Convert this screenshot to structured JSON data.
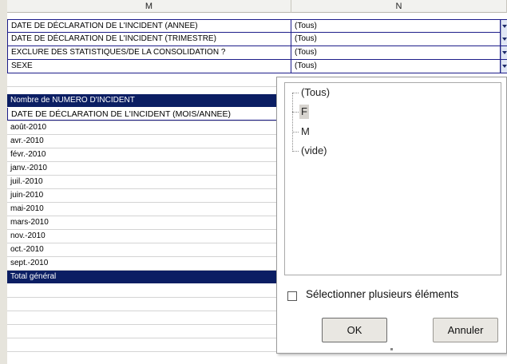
{
  "columns": {
    "m": "M",
    "n": "N"
  },
  "filters": [
    {
      "label": "DATE DE DÉCLARATION DE L'INCIDENT (ANNEE)",
      "value": "(Tous)"
    },
    {
      "label": "DATE DE DÉCLARATION DE L'INCIDENT (TRIMESTRE)",
      "value": "(Tous)"
    },
    {
      "label": "EXCLURE DES STATISTIQUES/DE LA CONSOLIDATION ?",
      "value": "(Tous)"
    },
    {
      "label": "SEXE",
      "value": "(Tous)"
    }
  ],
  "pivot": {
    "header": "Nombre de NUMERO D'INCIDENT",
    "row_field": "DATE DE DÉCLARATION DE L'INCIDENT (MOIS/ANNEE)",
    "rows": [
      "août-2010",
      "avr.-2010",
      "févr.-2010",
      "janv.-2010",
      "juil.-2010",
      "juin-2010",
      "mai-2010",
      "mars-2010",
      "nov.-2010",
      "oct.-2010",
      "sept.-2010"
    ],
    "total_label": "Total général"
  },
  "popup": {
    "options": [
      "(Tous)",
      "F",
      "M",
      "(vide)"
    ],
    "selected": "F",
    "multi_select_label": "Sélectionner plusieurs éléments",
    "ok_label": "OK",
    "cancel_label": "Annuler"
  }
}
